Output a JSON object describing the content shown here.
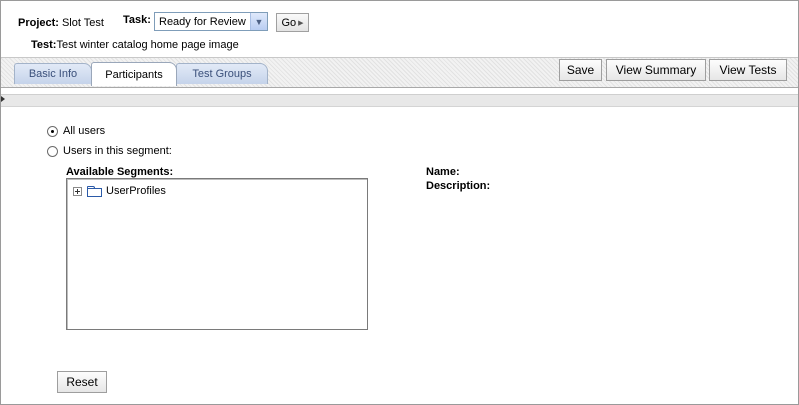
{
  "header": {
    "project_label": "Project:",
    "project_value": "Slot Test",
    "task_label": "Task:",
    "task_selected": "Ready for Review",
    "go_label": "Go",
    "test_label": "Test:",
    "test_value": "Test winter catalog home page image"
  },
  "tabs": [
    {
      "label": "Basic Info",
      "active": false
    },
    {
      "label": "Participants",
      "active": true
    },
    {
      "label": "Test Groups",
      "active": false
    }
  ],
  "toolbar": {
    "save_label": "Save",
    "view_summary_label": "View Summary",
    "view_tests_label": "View Tests"
  },
  "participants": {
    "all_users_label": "All users",
    "all_users_checked": true,
    "segment_label": "Users in this segment:",
    "segment_checked": false,
    "available_segments_label": "Available Segments:",
    "tree": [
      {
        "label": "UserProfiles",
        "icon": "folder-icon",
        "expander": "plus-icon"
      }
    ],
    "name_label": "Name:",
    "description_label": "Description:",
    "reset_label": "Reset"
  },
  "colors": {
    "tab_inactive_bg": "#c5d3ea",
    "tab_inactive_text": "#3a4f7a",
    "select_border": "#7f9db9",
    "folder_outline": "#2b5aa8"
  }
}
